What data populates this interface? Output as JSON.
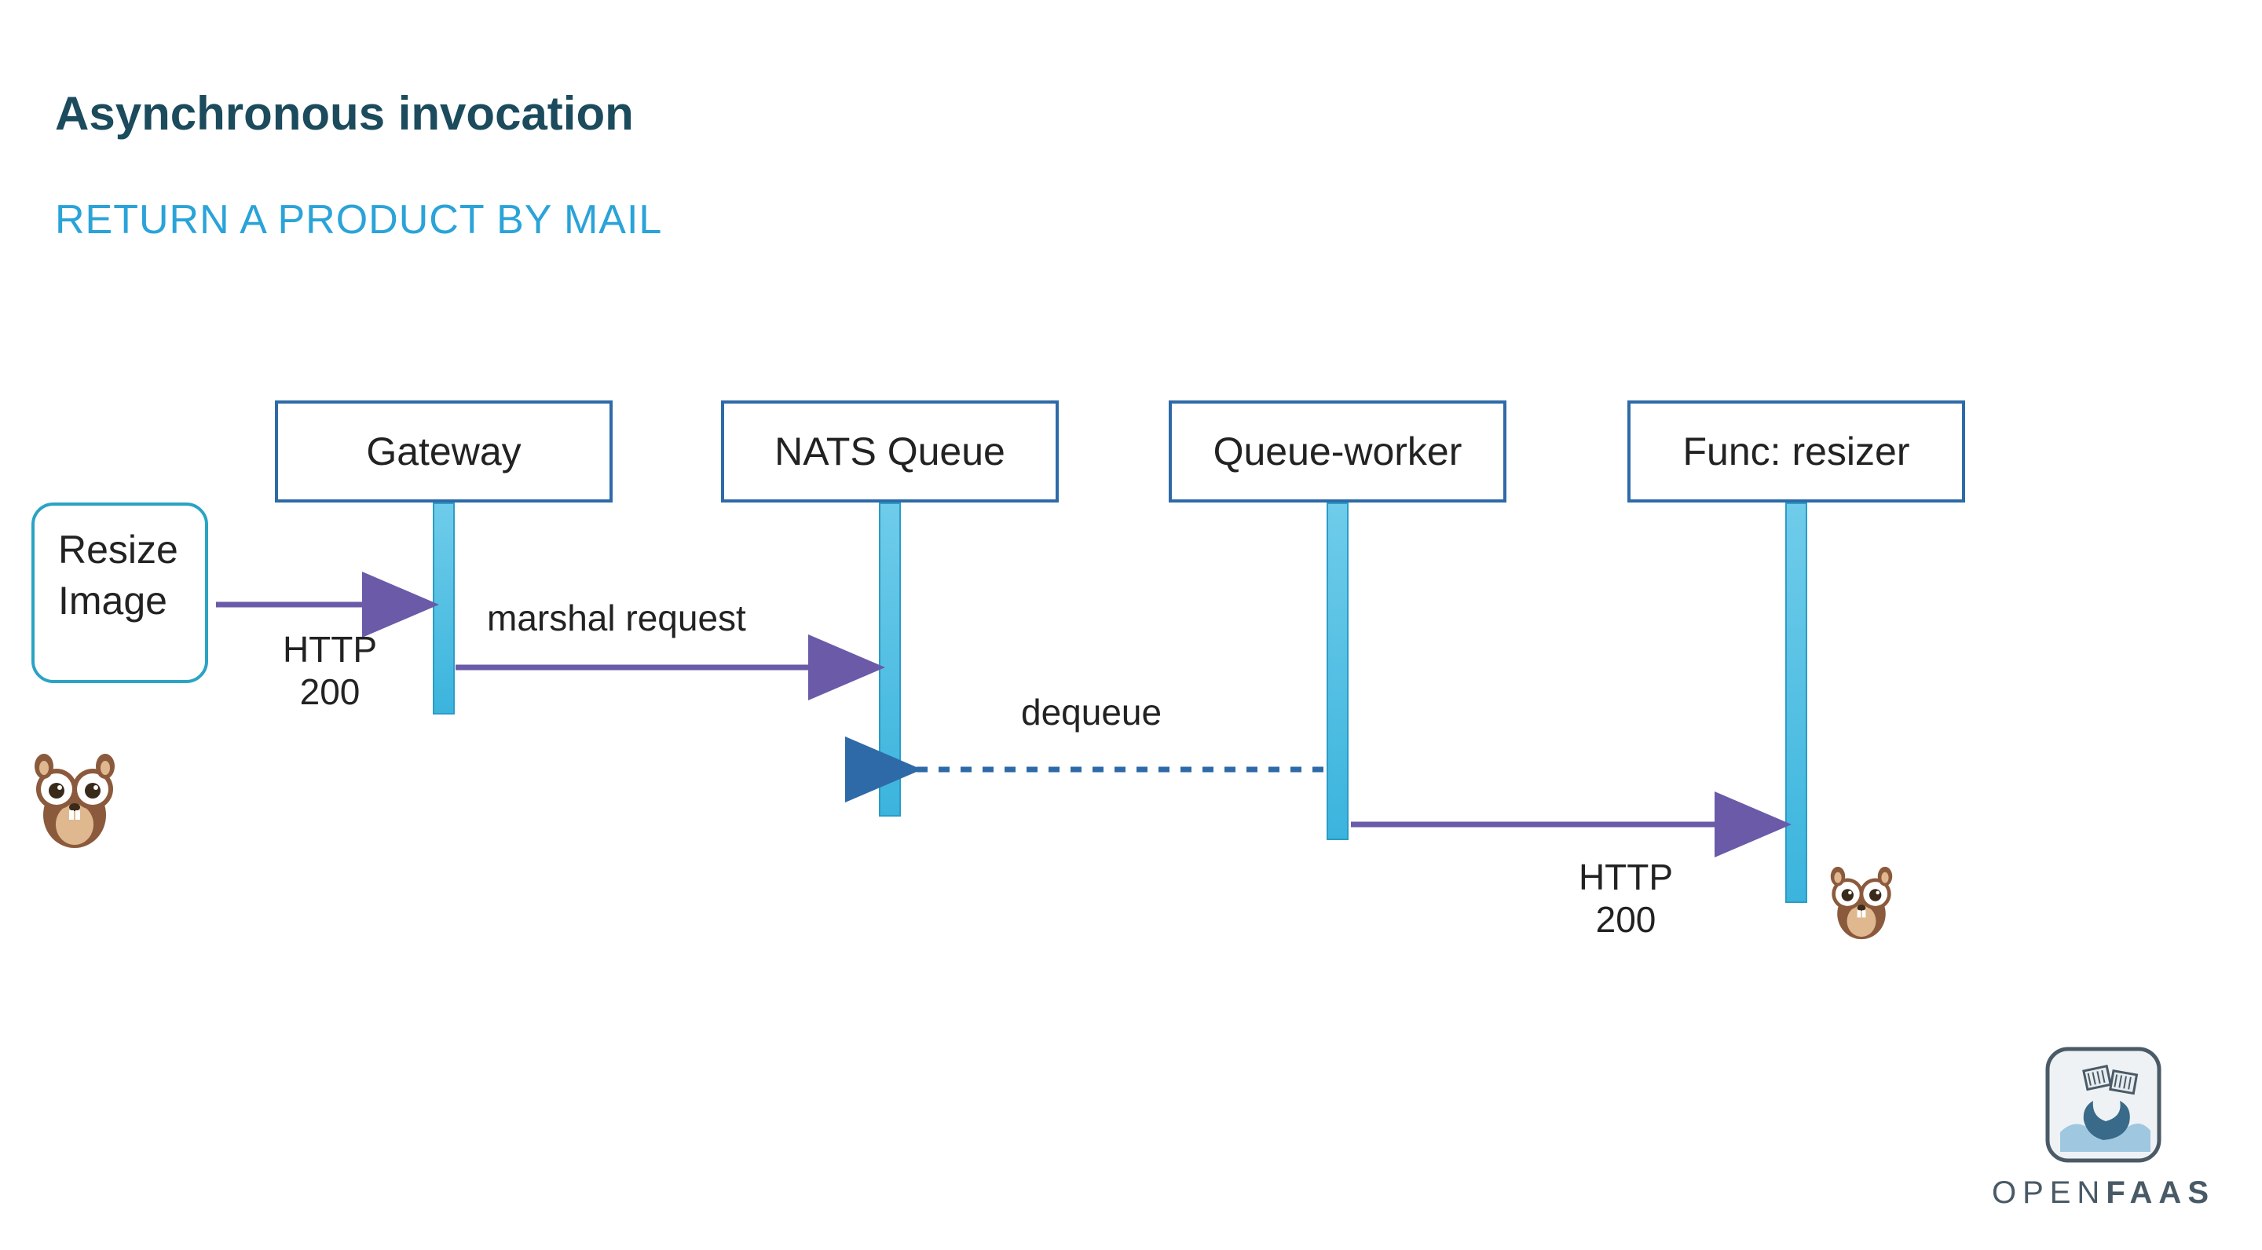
{
  "title": "Asynchronous invocation",
  "subtitle": "RETURN A PRODUCT BY MAIL",
  "actor": {
    "line1": "Resize",
    "line2": "Image"
  },
  "participants": {
    "gateway": "Gateway",
    "nats": "NATS Queue",
    "worker": "Queue-worker",
    "func": "Func: resizer"
  },
  "messages": {
    "m1_label_top": "",
    "m1_label_bottom1": "HTTP",
    "m1_label_bottom2": "200",
    "m2": "marshal request",
    "m3": "dequeue",
    "m4_bottom1": "HTTP",
    "m4_bottom2": "200"
  },
  "brand": {
    "name_a": "OPEN",
    "name_b": "FAAS"
  }
}
